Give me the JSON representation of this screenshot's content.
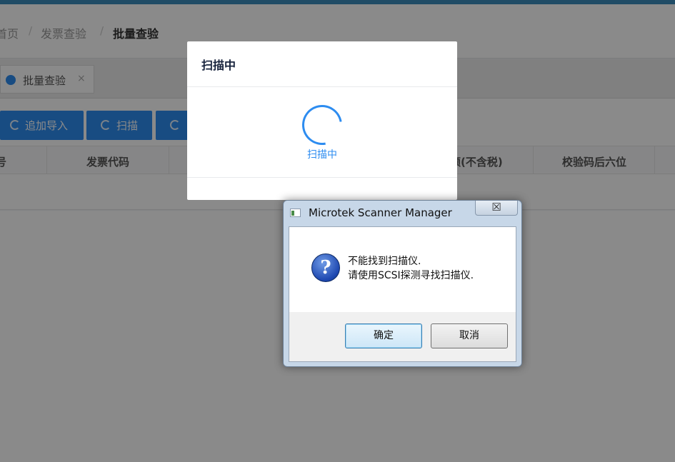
{
  "breadcrumb": {
    "items": [
      "首页",
      "发票查验",
      "批量查验"
    ],
    "separator": "/"
  },
  "tabs": [
    {
      "label": "批量查验",
      "close": "×"
    }
  ],
  "toolbar": {
    "append_import": "追加导入",
    "scan": "扫描"
  },
  "table": {
    "headers": [
      "号",
      "发票代码",
      "额(不含税)",
      "校验码后六位"
    ]
  },
  "scan_modal": {
    "title": "扫描中",
    "status": "扫描中"
  },
  "dialog": {
    "title": "Microtek Scanner Manager",
    "close_glyph": "☒",
    "message_line1": "不能找到扫描仪.",
    "message_line2": "请使用SCSI探测寻找扫描仪.",
    "ok_label": "确定",
    "cancel_label": "取消",
    "icon": "question-icon"
  },
  "colors": {
    "accent": "#2d8cf0",
    "topbar": "#3c8dbc"
  }
}
